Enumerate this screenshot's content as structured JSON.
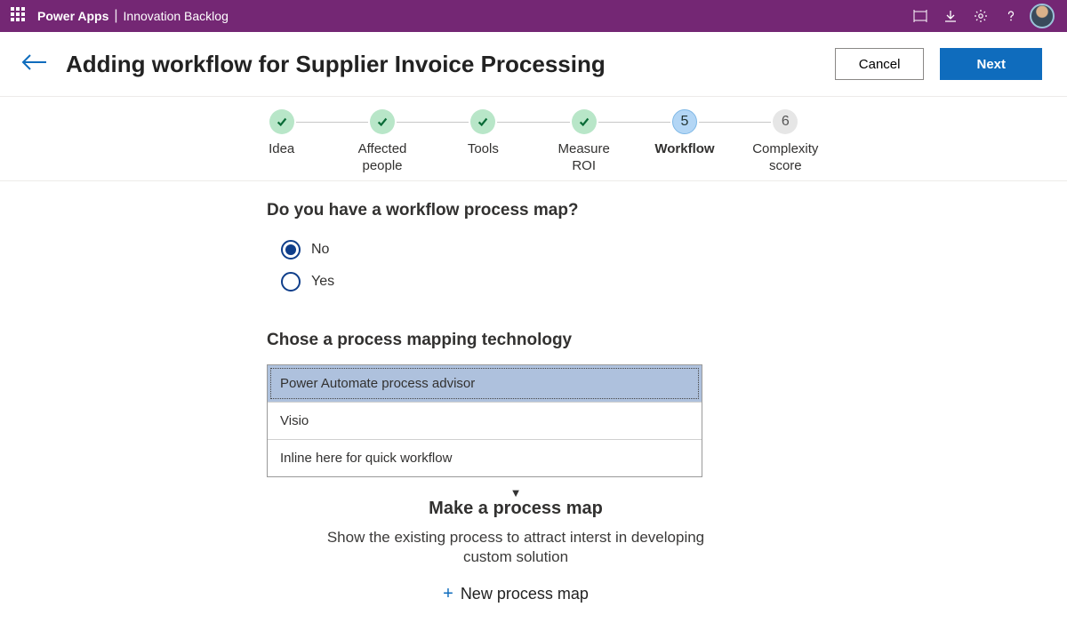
{
  "appbar": {
    "product": "Power Apps",
    "separator": "|",
    "appName": "Innovation Backlog"
  },
  "header": {
    "title": "Adding workflow for Supplier Invoice Processing",
    "cancel": "Cancel",
    "next": "Next"
  },
  "stepper": {
    "steps": [
      {
        "label": "Idea",
        "state": "done"
      },
      {
        "label": "Affected people",
        "state": "done"
      },
      {
        "label": "Tools",
        "state": "done"
      },
      {
        "label": "Measure ROI",
        "state": "done"
      },
      {
        "label": "Workflow",
        "state": "current",
        "num": "5"
      },
      {
        "label": "Complexity score",
        "state": "future",
        "num": "6"
      }
    ]
  },
  "form": {
    "q1": "Do you have a workflow process map?",
    "radios": {
      "no": "No",
      "yes": "Yes",
      "selected": "no"
    },
    "q2": "Chose a process mapping technology",
    "options": [
      {
        "label": "Power Automate process advisor",
        "selected": true
      },
      {
        "label": "Visio",
        "selected": false
      },
      {
        "label": "Inline here for quick workflow",
        "selected": false
      }
    ],
    "sectionTitle": "Make a process map",
    "sectionDesc": "Show the existing process to attract interst in developing custom solution",
    "addLink": "New process map"
  }
}
